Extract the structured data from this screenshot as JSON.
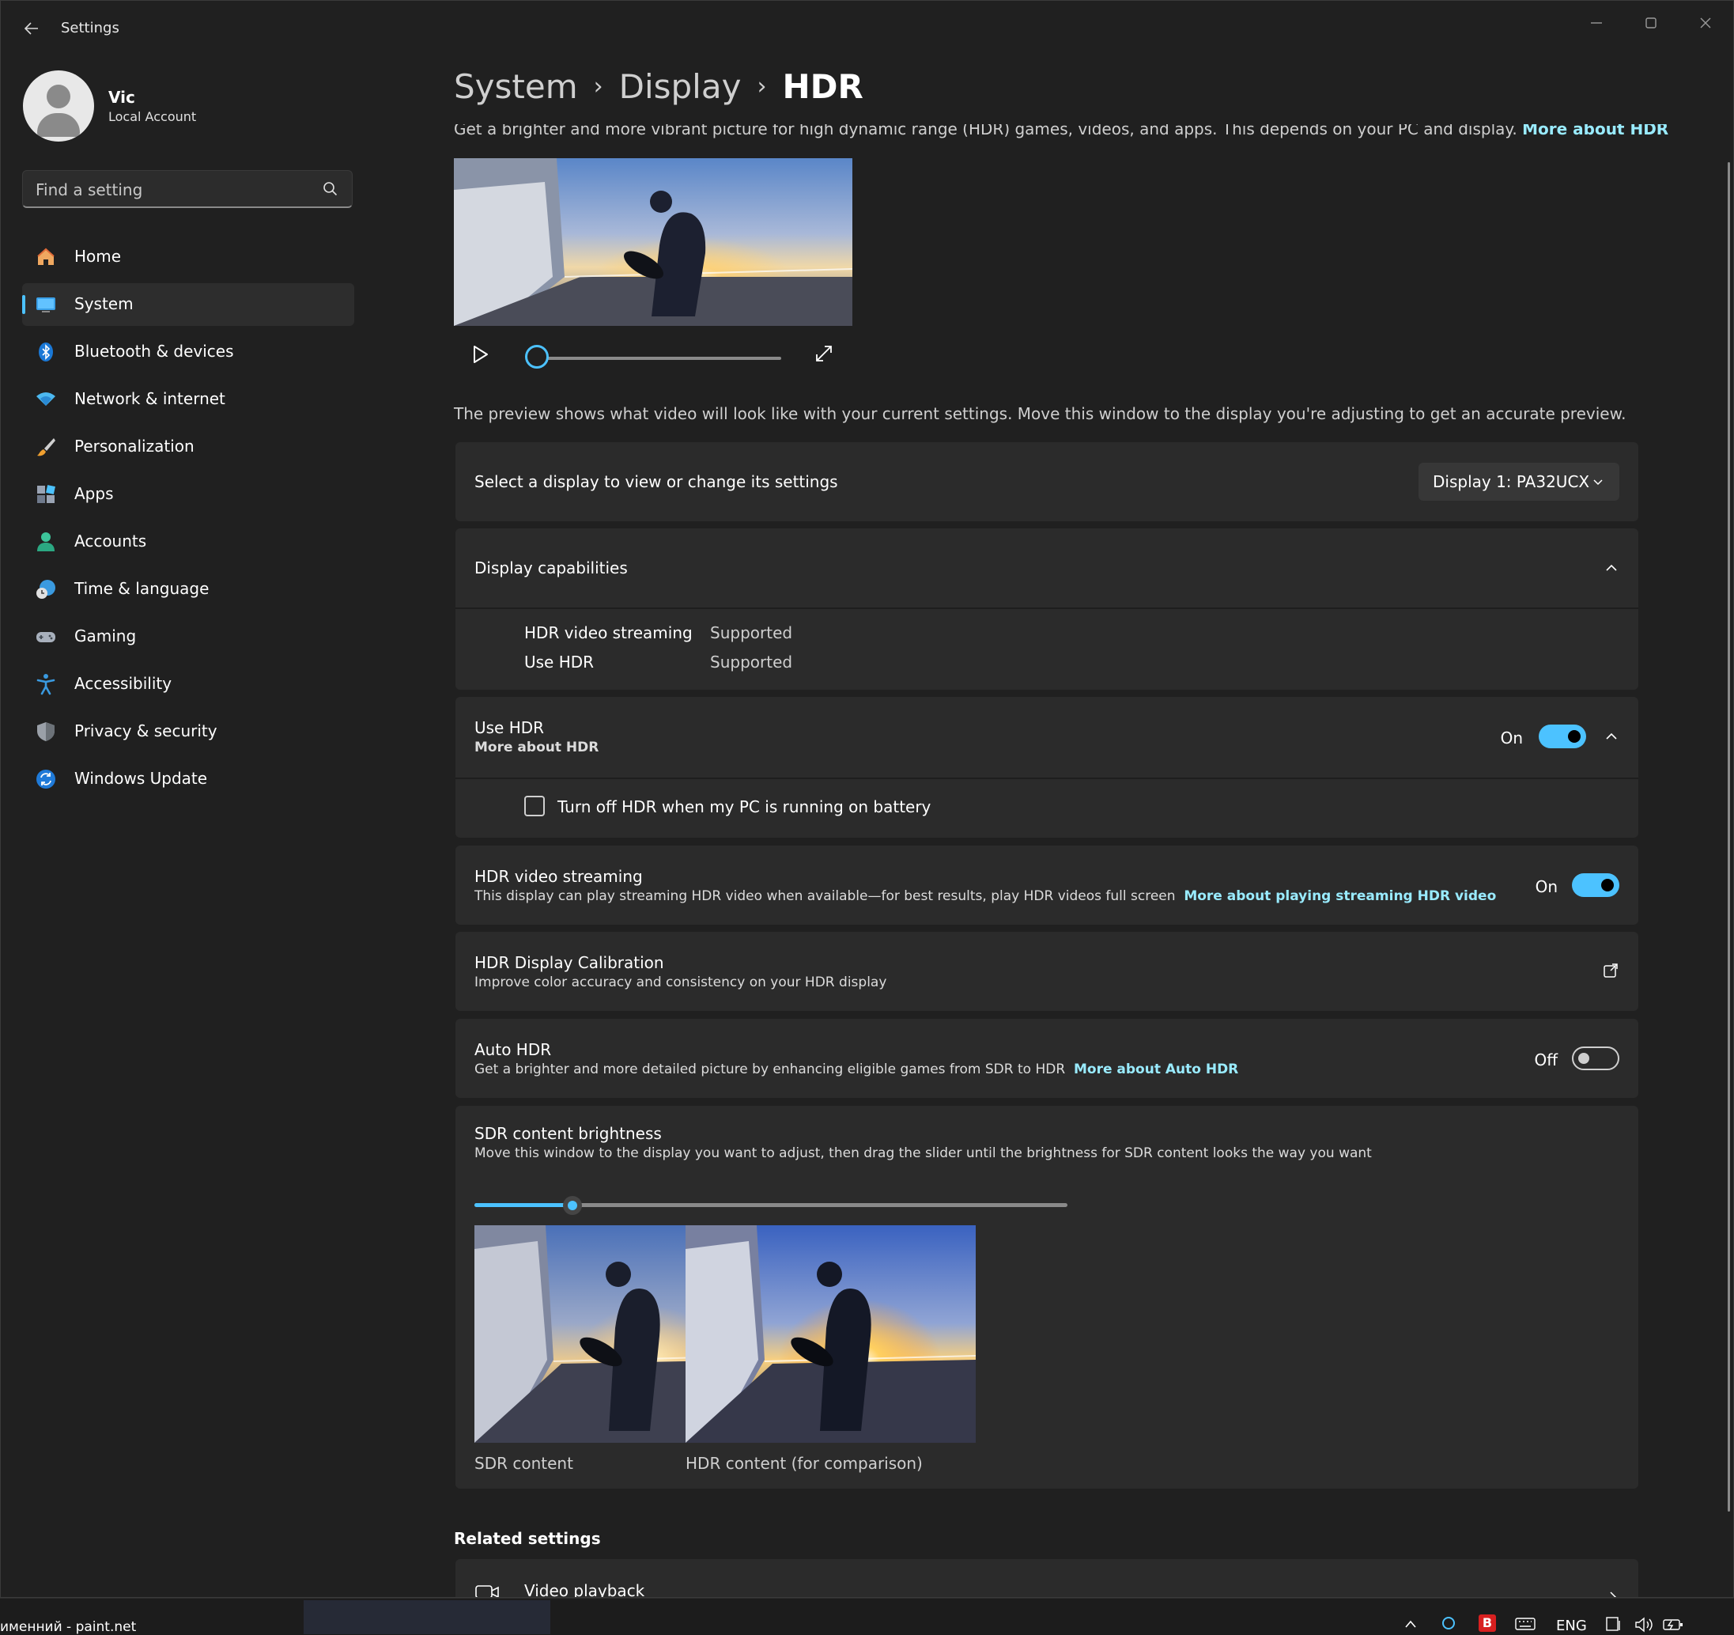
{
  "window": {
    "title": "Settings"
  },
  "user": {
    "name": "Vic",
    "account_type": "Local Account"
  },
  "search": {
    "placeholder": "Find a setting"
  },
  "sidebar": {
    "items": [
      {
        "label": "Home",
        "icon": "home-icon"
      },
      {
        "label": "System",
        "icon": "system-icon",
        "active": true
      },
      {
        "label": "Bluetooth & devices",
        "icon": "bluetooth-icon"
      },
      {
        "label": "Network & internet",
        "icon": "wifi-icon"
      },
      {
        "label": "Personalization",
        "icon": "brush-icon"
      },
      {
        "label": "Apps",
        "icon": "apps-icon"
      },
      {
        "label": "Accounts",
        "icon": "accounts-icon"
      },
      {
        "label": "Time & language",
        "icon": "globe-clock-icon"
      },
      {
        "label": "Gaming",
        "icon": "gamepad-icon"
      },
      {
        "label": "Accessibility",
        "icon": "accessibility-icon"
      },
      {
        "label": "Privacy & security",
        "icon": "shield-icon"
      },
      {
        "label": "Windows Update",
        "icon": "update-icon"
      }
    ]
  },
  "breadcrumb": {
    "level1": "System",
    "level2": "Display",
    "current": "HDR",
    "separator": "›"
  },
  "intro": {
    "text": "Get a brighter and more vibrant picture for high dynamic range (HDR) games, videos, and apps. This depends on your PC and display.",
    "link": "More about HDR"
  },
  "video_preview": {
    "progress": 0.0
  },
  "preview_note": "The preview shows what video will look like with your current settings. Move this window to the display you're adjusting to get an accurate preview.",
  "display_select": {
    "label": "Select a display to view or change its settings",
    "value": "Display 1: PA32UCX"
  },
  "capabilities": {
    "title": "Display capabilities",
    "rows": [
      {
        "name": "HDR video streaming",
        "value": "Supported"
      },
      {
        "name": "Use HDR",
        "value": "Supported"
      }
    ]
  },
  "use_hdr": {
    "title": "Use HDR",
    "link": "More about HDR",
    "state": "On",
    "battery_option": "Turn off HDR when my PC is running on battery",
    "battery_checked": false
  },
  "hdr_streaming": {
    "title": "HDR video streaming",
    "desc": "This display can play streaming HDR video when available—for best results, play HDR videos full screen",
    "link": "More about playing streaming HDR video",
    "state": "On"
  },
  "calibration": {
    "title": "HDR Display Calibration",
    "desc": "Improve color accuracy and consistency on your HDR display"
  },
  "auto_hdr": {
    "title": "Auto HDR",
    "desc": "Get a brighter and more detailed picture by enhancing eligible games from SDR to HDR",
    "link": "More about Auto HDR",
    "state": "Off"
  },
  "sdr_brightness": {
    "title": "SDR content brightness",
    "desc": "Move this window to the display you want to adjust, then drag the slider until the brightness for SDR content looks the way you want",
    "value_fraction": 0.165,
    "sdr_caption": "SDR content",
    "hdr_caption": "HDR content (for comparison)"
  },
  "related": {
    "title": "Related settings",
    "video_playback": "Video playback"
  },
  "taskbar": {
    "app_label": "именний - paint.net",
    "language": "ENG"
  },
  "colors": {
    "accent": "#4cc2ff",
    "link": "#99ebff",
    "background": "#202020",
    "card": "#2b2b2b"
  }
}
